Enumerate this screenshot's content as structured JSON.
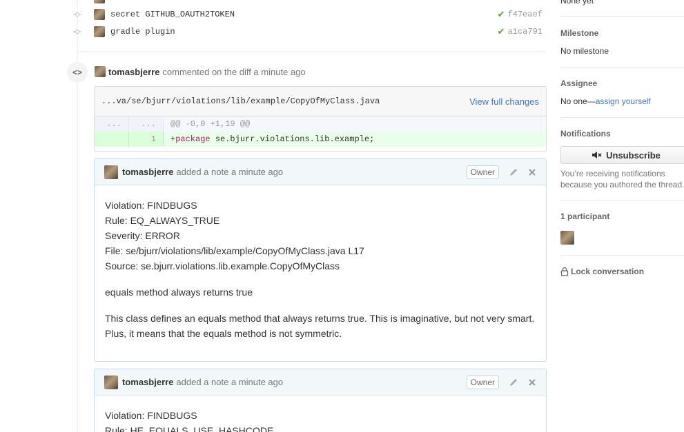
{
  "commits": [
    {
      "message": "secret GITHUB_OAUTH2TOKEN",
      "sha": "f47eaef",
      "status": "✔"
    },
    {
      "message": "gradle plugin",
      "sha": "a1ca791",
      "status": "✔"
    }
  ],
  "comment": {
    "author": "tomasbjerre",
    "action": "commented on the diff a minute ago",
    "diff": {
      "path": "...va/se/bjurr/violations/lib/example/CopyOfMyClass.java",
      "view_link": "View full changes",
      "hunk_left": "...",
      "hunk_right": "...",
      "hunk_header": "@@ -0,0 +1,19 @@",
      "line_number": "1",
      "line_prefix": "+",
      "line_keyword": "package",
      "line_rest": " se.bjurr.violations.lib.example;"
    }
  },
  "notes": [
    {
      "author": "tomasbjerre",
      "action": "added a note a minute ago",
      "badge": "Owner",
      "lines": [
        "Violation: FINDBUGS",
        "Rule: EQ_ALWAYS_TRUE",
        "Severity: ERROR",
        "File: se/bjurr/violations/lib/example/CopyOfMyClass.java L17",
        "Source: se.bjurr.violations.lib.example.CopyOfMyClass"
      ],
      "summary": "equals method always returns true",
      "description": "This class defines an equals method that always returns true. This is imaginative, but not very smart. Plus, it means that the equals method is not symmetric."
    },
    {
      "author": "tomasbjerre",
      "action": "added a note a minute ago",
      "badge": "Owner",
      "lines": [
        "Violation: FINDBUGS",
        "Rule: HE_EQUALS_USE_HASHCODE"
      ]
    }
  ],
  "sidebar": {
    "labels_value": "None yet",
    "milestone_label": "Milestone",
    "milestone_value": "No milestone",
    "assignee_label": "Assignee",
    "assignee_value": "No one—",
    "assignee_link": "assign yourself",
    "notifications_label": "Notifications",
    "unsubscribe_label": "Unsubscribe",
    "notifications_text": "You’re receiving notifications because you authored the thread.",
    "participants_label": "1 participant",
    "lock_label": "Lock conversation"
  },
  "icons": {
    "commit": "git-commit-icon",
    "diff": "code-icon",
    "edit": "pencil-icon",
    "close": "close-icon",
    "mute": "mute-icon",
    "lock": "lock-icon"
  },
  "colors": {
    "link": "#4078c0",
    "success": "#55a532",
    "addition_bg": "#eaffea",
    "note_header_bg": "#f2f8fa"
  }
}
